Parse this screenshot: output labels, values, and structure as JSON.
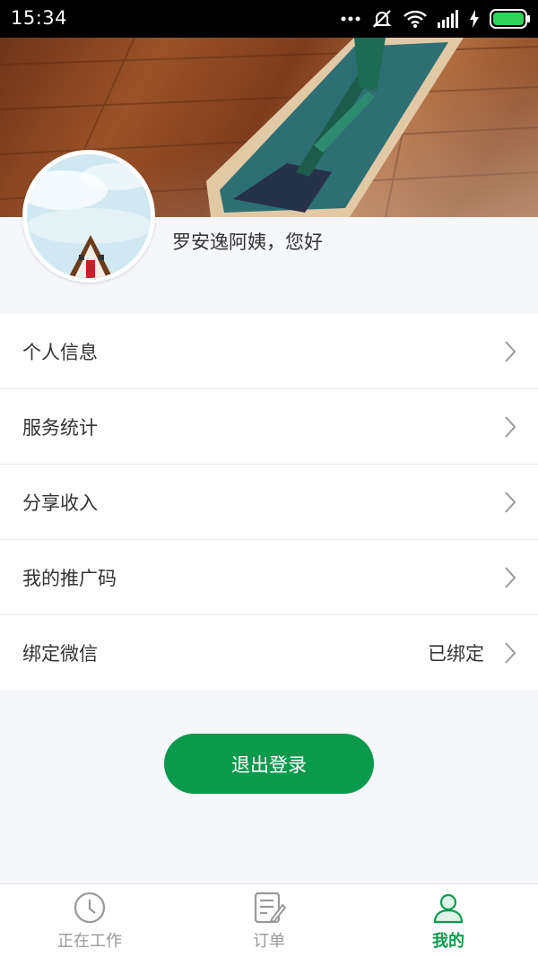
{
  "status_bar": {
    "time": "15:34",
    "icons": [
      "more-dots-icon",
      "mute-icon",
      "wifi-icon",
      "signal-icon",
      "charging-icon",
      "battery-icon"
    ]
  },
  "profile": {
    "greeting": "罗安逸阿姨，您好"
  },
  "menu": {
    "items": [
      {
        "label": "个人信息",
        "value": ""
      },
      {
        "label": "服务统计",
        "value": ""
      },
      {
        "label": "分享收入",
        "value": ""
      },
      {
        "label": "我的推广码",
        "value": ""
      },
      {
        "label": "绑定微信",
        "value": "已绑定"
      }
    ]
  },
  "logout": {
    "label": "退出登录"
  },
  "tabbar": {
    "tabs": [
      {
        "label": "正在工作",
        "icon": "clock-icon",
        "active": false
      },
      {
        "label": "订单",
        "icon": "order-list-icon",
        "active": false
      },
      {
        "label": "我的",
        "icon": "person-icon",
        "active": true
      }
    ]
  },
  "colors": {
    "accent": "#0a9a4c",
    "status_bar_bg": "#000000",
    "text": "#333333",
    "inactive_tab": "#999999",
    "background": "#f6f7fb"
  }
}
